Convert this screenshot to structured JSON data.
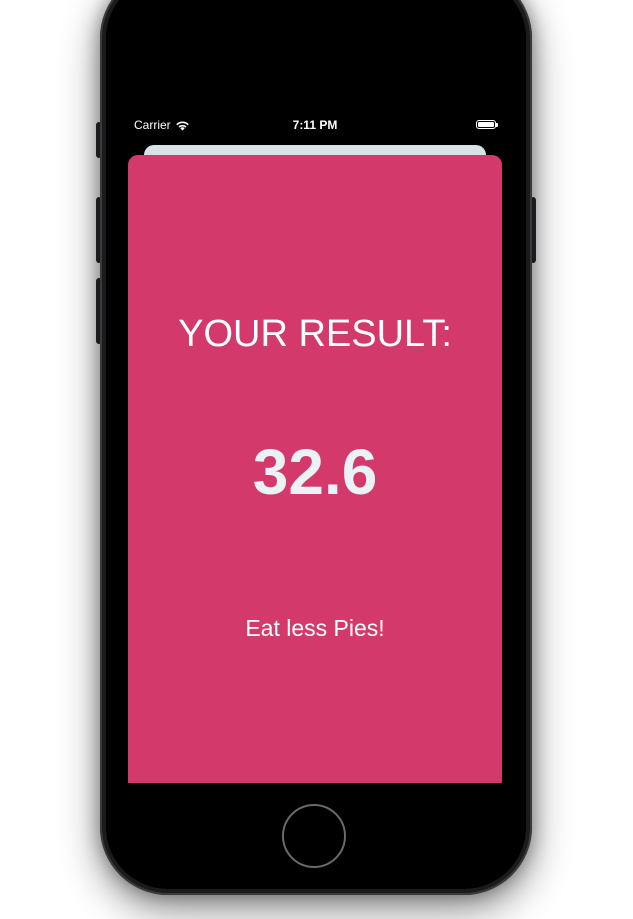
{
  "status_bar": {
    "carrier": "Carrier",
    "time": "7:11 PM",
    "wifi_icon": "wifi-icon",
    "battery_icon": "battery-icon"
  },
  "result": {
    "title": "YOUR RESULT:",
    "value": "32.6",
    "advice": "Eat less Pies!"
  },
  "colors": {
    "card_background": "#d33a6b",
    "sheet_background": "#d8e2e7",
    "value_text": "#eaf2f6"
  }
}
